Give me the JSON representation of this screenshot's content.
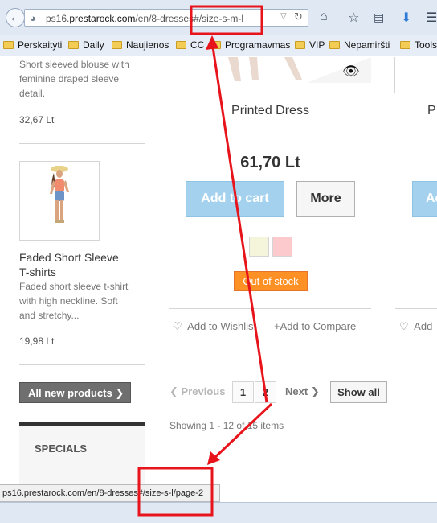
{
  "browser": {
    "url_prefix": "ps16.",
    "url_domain": "prestarock.com",
    "url_path": "/en/8-dresses#/size-s-m-l",
    "bookmarks": [
      "Perskaityti",
      "Daily",
      "Naujienos",
      "CC",
      "Programavmas",
      "VIP",
      "Nepamiršti",
      "Tools"
    ],
    "status_url": "ps16.prestarock.com/en/8-dresses#/size-s-l/page-2"
  },
  "sidebar": {
    "top_product": {
      "desc": [
        "Short sleeved blouse with",
        "feminine draped sleeve",
        "detail."
      ],
      "price": "32,67 Lt"
    },
    "product2": {
      "name": [
        "Faded Short Sleeve",
        "T-shirts"
      ],
      "desc": [
        "Faded short sleeve t-shirt",
        "with high neckline. Soft",
        "and stretchy..."
      ],
      "price": "19,98 Lt"
    },
    "all_new_label": "All new products",
    "specials_label": "SPECIALS"
  },
  "product": {
    "name": "Printed Dress",
    "name_right_partial": "P",
    "price": "61,70 Lt",
    "add_to_cart": "Add to cart",
    "add_to_cart_right_partial": "Ad",
    "more": "More",
    "out_of_stock": "Out of stock",
    "wishlist": "Add to Wishlist",
    "compare": "Add to Compare",
    "wishlist_right_partial": "Add",
    "swatch_colors": [
      "#f5f5dc",
      "#fcc9cd"
    ]
  },
  "pagination": {
    "previous": "Previous",
    "pages": [
      "1",
      "2"
    ],
    "next": "Next",
    "show_all": "Show all",
    "showing": "Showing 1 - 12 of 15 items"
  },
  "colors": {
    "annotation_red": "#e8141b",
    "cart_blue": "#a3d1ee",
    "stock_orange": "#fe9126"
  }
}
